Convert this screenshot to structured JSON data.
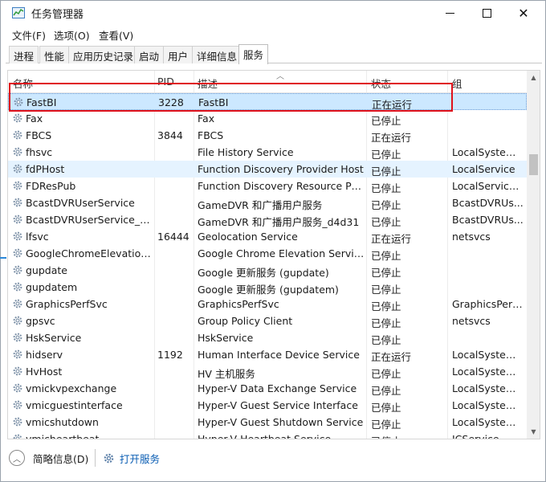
{
  "window": {
    "title": "任务管理器"
  },
  "menu": [
    {
      "label": "文件(F)"
    },
    {
      "label": "选项(O)"
    },
    {
      "label": "查看(V)"
    }
  ],
  "tabs": [
    {
      "label": "进程"
    },
    {
      "label": "性能"
    },
    {
      "label": "应用历史记录"
    },
    {
      "label": "启动"
    },
    {
      "label": "用户"
    },
    {
      "label": "详细信息"
    },
    {
      "label": "服务",
      "active": true
    }
  ],
  "columns": {
    "name": "名称",
    "pid": "PID",
    "desc": "描述",
    "status": "状态",
    "group": "组"
  },
  "rows": [
    {
      "name": "FastBI",
      "pid": "3228",
      "desc": "FastBI",
      "status": "正在运行",
      "group": ""
    },
    {
      "name": "Fax",
      "pid": "",
      "desc": "Fax",
      "status": "已停止",
      "group": ""
    },
    {
      "name": "FBCS",
      "pid": "3844",
      "desc": "FBCS",
      "status": "正在运行",
      "group": ""
    },
    {
      "name": "fhsvc",
      "pid": "",
      "desc": "File History Service",
      "status": "已停止",
      "group": "LocalSystem..."
    },
    {
      "name": "fdPHost",
      "pid": "",
      "desc": "Function Discovery Provider Host",
      "status": "已停止",
      "group": "LocalService"
    },
    {
      "name": "FDResPub",
      "pid": "",
      "desc": "Function Discovery Resource Pub...",
      "status": "已停止",
      "group": "LocalService..."
    },
    {
      "name": "BcastDVRUserService",
      "pid": "",
      "desc": "GameDVR 和广播用户服务",
      "status": "已停止",
      "group": "BcastDVRUs..."
    },
    {
      "name": "BcastDVRUserService_d4...",
      "pid": "",
      "desc": "GameDVR 和广播用户服务_d4d31",
      "status": "已停止",
      "group": "BcastDVRUs..."
    },
    {
      "name": "lfsvc",
      "pid": "16444",
      "desc": "Geolocation Service",
      "status": "正在运行",
      "group": "netsvcs"
    },
    {
      "name": "GoogleChromeElevation...",
      "pid": "",
      "desc": "Google Chrome Elevation Servic...",
      "status": "已停止",
      "group": ""
    },
    {
      "name": "gupdate",
      "pid": "",
      "desc": "Google 更新服务 (gupdate)",
      "status": "已停止",
      "group": ""
    },
    {
      "name": "gupdatem",
      "pid": "",
      "desc": "Google 更新服务 (gupdatem)",
      "status": "已停止",
      "group": ""
    },
    {
      "name": "GraphicsPerfSvc",
      "pid": "",
      "desc": "GraphicsPerfSvc",
      "status": "已停止",
      "group": "GraphicsPerf..."
    },
    {
      "name": "gpsvc",
      "pid": "",
      "desc": "Group Policy Client",
      "status": "已停止",
      "group": "netsvcs"
    },
    {
      "name": "HskService",
      "pid": "",
      "desc": "HskService",
      "status": "已停止",
      "group": ""
    },
    {
      "name": "hidserv",
      "pid": "1192",
      "desc": "Human Interface Device Service",
      "status": "正在运行",
      "group": "LocalSystem..."
    },
    {
      "name": "HvHost",
      "pid": "",
      "desc": "HV 主机服务",
      "status": "已停止",
      "group": "LocalSystem..."
    },
    {
      "name": "vmickvpexchange",
      "pid": "",
      "desc": "Hyper-V Data Exchange Service",
      "status": "已停止",
      "group": "LocalSystem..."
    },
    {
      "name": "vmicguestinterface",
      "pid": "",
      "desc": "Hyper-V Guest Service Interface",
      "status": "已停止",
      "group": "LocalSystem..."
    },
    {
      "name": "vmicshutdown",
      "pid": "",
      "desc": "Hyper-V Guest Shutdown Service",
      "status": "已停止",
      "group": "LocalSystem..."
    },
    {
      "name": "vmicheartbeat",
      "pid": "",
      "desc": "Hyper-V Heartbeat Service",
      "status": "已停止",
      "group": "ICService"
    }
  ],
  "bottom": {
    "brief": "简略信息(D)",
    "open_services": "打开服务"
  },
  "colors": {
    "selected_row": "#cce8ff",
    "annotation": "#e0121c",
    "link": "#0a5db3"
  }
}
